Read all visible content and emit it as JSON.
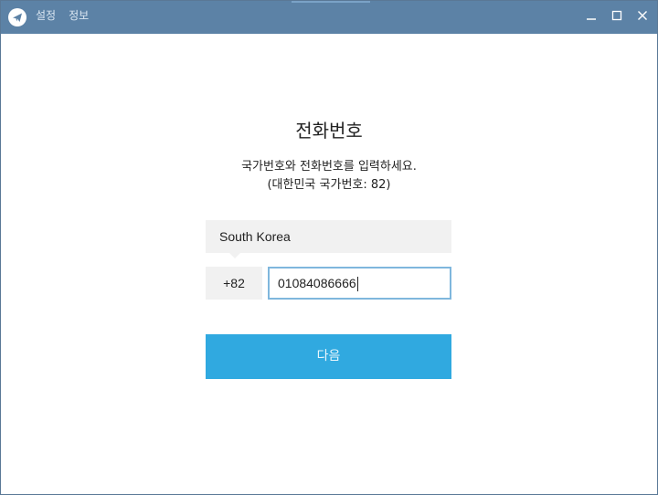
{
  "menu": {
    "settings_label": "설정",
    "info_label": "정보"
  },
  "window_controls": [
    "minimize",
    "maximize",
    "close"
  ],
  "colors": {
    "titlebar": "#5c82a6",
    "primary_button": "#30a9e0",
    "input_focus_border": "#7fb7dd",
    "field_background": "#f1f1f1"
  },
  "form": {
    "title": "전화번호",
    "description_line1": "국가번호와 전화번호를 입력하세요.",
    "description_line2": "(대한민국 국가번호: 82)",
    "country_value": "South Korea",
    "country_code": "+82",
    "phone_value": "01084086666",
    "next_label": "다음"
  }
}
